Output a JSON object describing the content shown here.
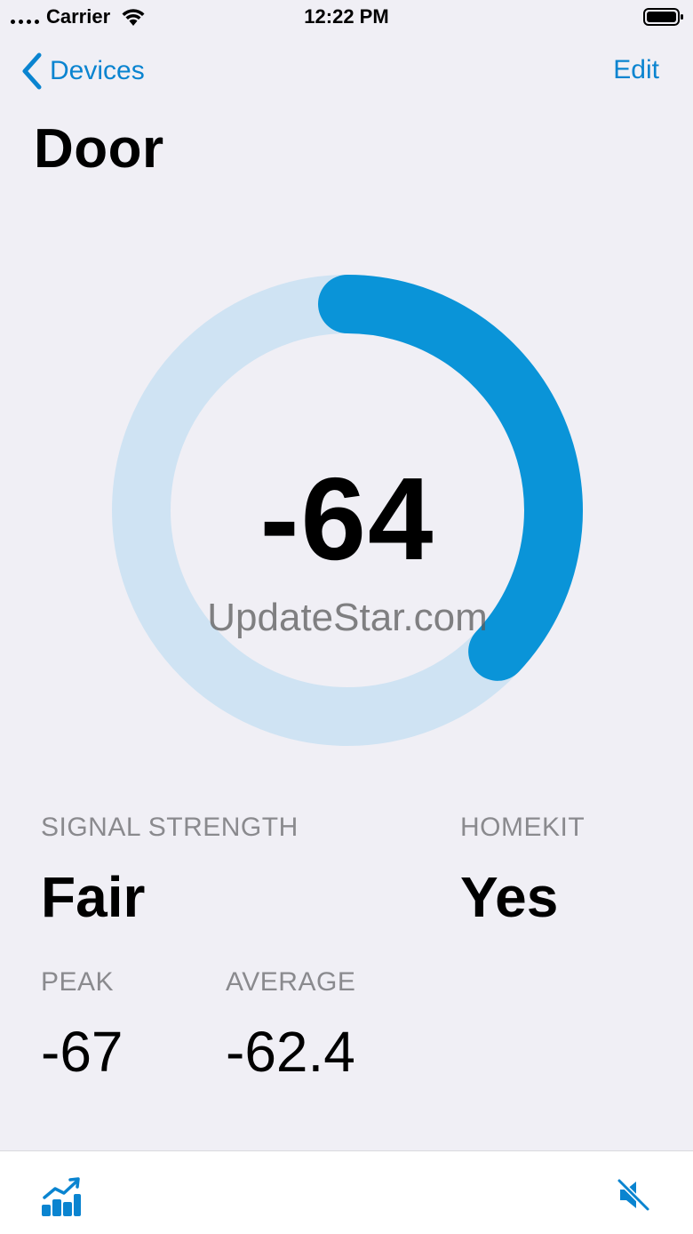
{
  "status_bar": {
    "carrier": "Carrier",
    "time": "12:22 PM"
  },
  "nav": {
    "back_label": "Devices",
    "edit_label": "Edit"
  },
  "page": {
    "title": "Door"
  },
  "gauge": {
    "value": "-64",
    "progress_fraction": 0.37,
    "track_color": "#cfe3f3",
    "fill_color": "#0a94d8"
  },
  "watermark": "UpdateStar.com",
  "stats": {
    "signal_strength": {
      "label": "SIGNAL STRENGTH",
      "value": "Fair"
    },
    "homekit": {
      "label": "HOMEKIT",
      "value": "Yes"
    },
    "peak": {
      "label": "PEAK",
      "value": "-67"
    },
    "average": {
      "label": "AVERAGE",
      "value": "-62.4"
    }
  },
  "tab_bar": {
    "left_icon": "chart-icon",
    "right_icon": "speaker-muted-icon",
    "accent": "#0a84d0"
  }
}
